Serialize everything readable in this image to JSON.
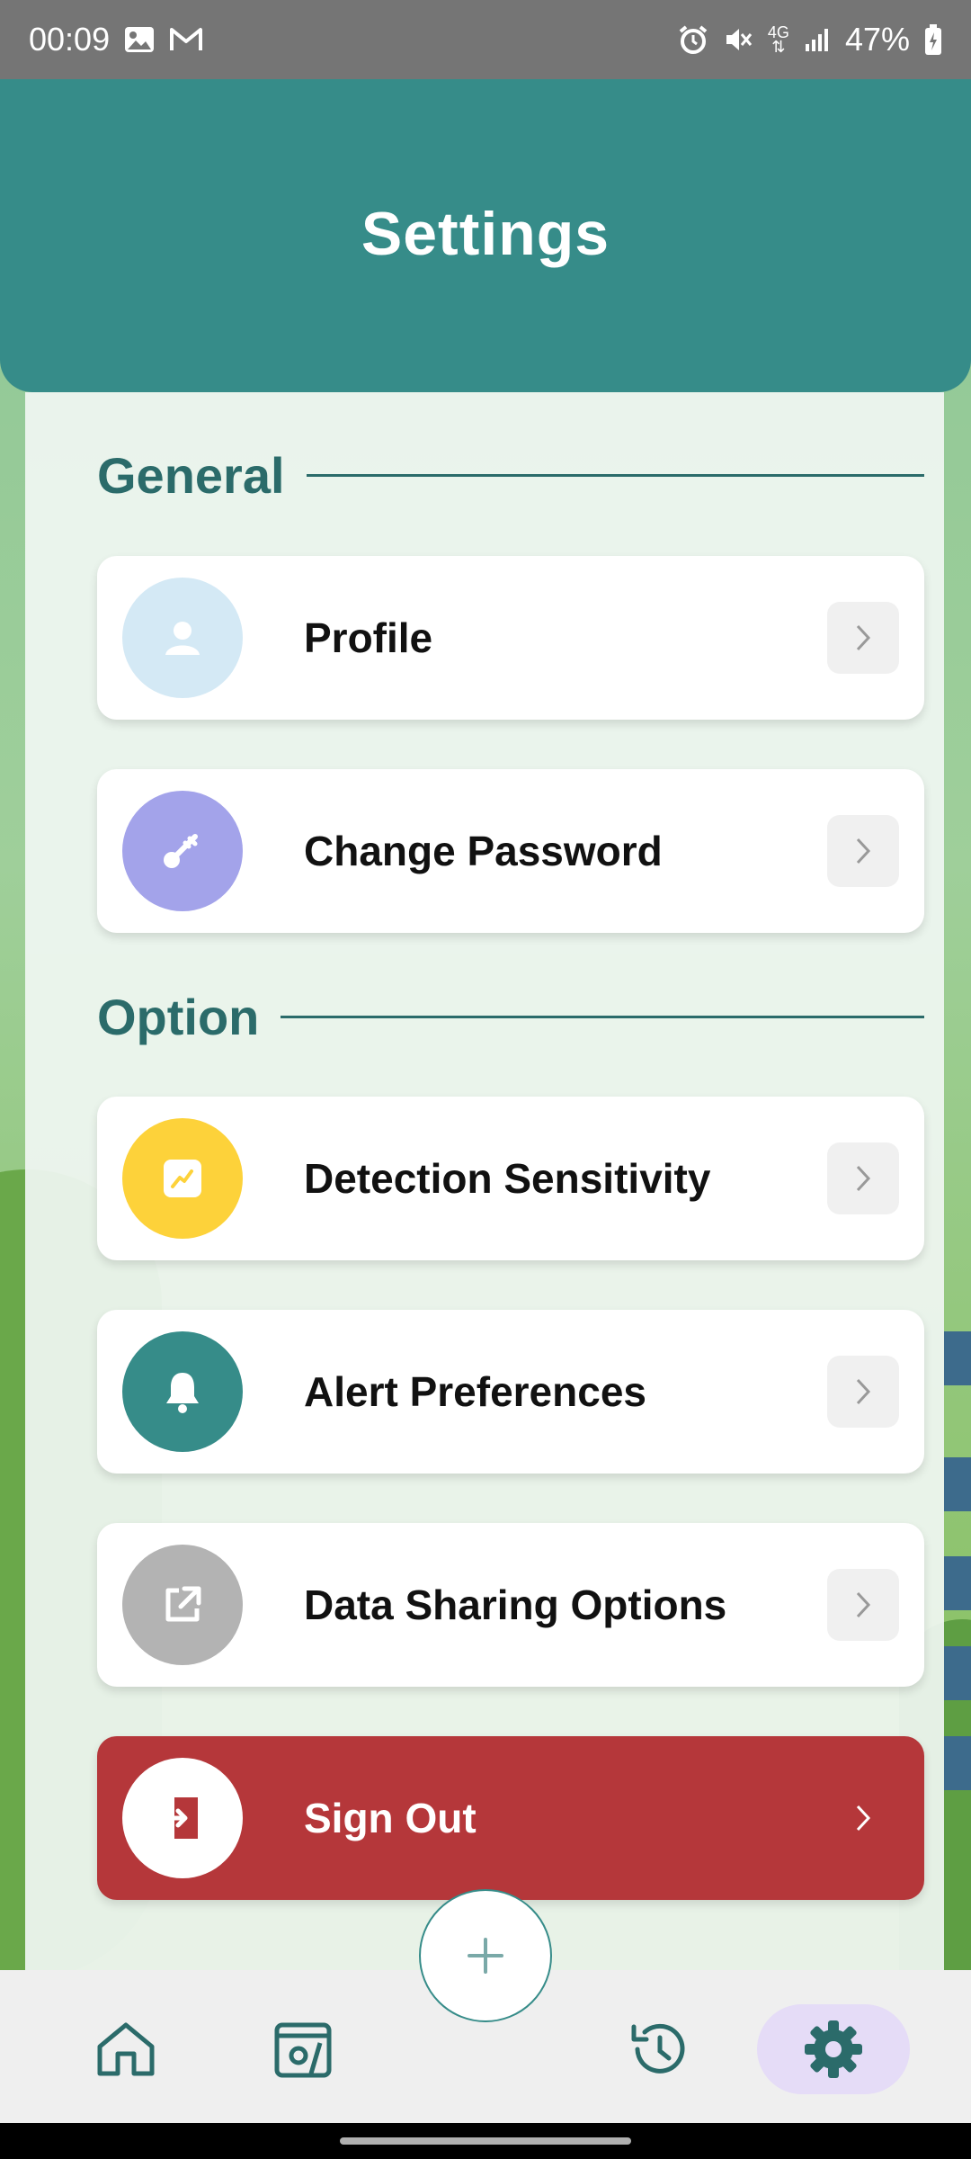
{
  "status_bar": {
    "time": "00:09",
    "battery": "47%",
    "network": "4G"
  },
  "header": {
    "title": "Settings"
  },
  "sections": {
    "general": {
      "title": "General"
    },
    "option": {
      "title": "Option"
    }
  },
  "items": {
    "profile": {
      "label": "Profile",
      "icon": "person-icon",
      "color": "#d4e9f5"
    },
    "change_password": {
      "label": "Change Password",
      "icon": "key-icon",
      "color": "#a3a3ea"
    },
    "detection_sensitivity": {
      "label": "Detection Sensitivity",
      "icon": "trend-icon",
      "color": "#fdd23a"
    },
    "alert_preferences": {
      "label": "Alert Preferences",
      "icon": "bell-icon",
      "color": "#368c89"
    },
    "data_sharing": {
      "label": "Data Sharing Options",
      "icon": "share-icon",
      "color": "#b3b3b3"
    },
    "sign_out": {
      "label": "Sign Out",
      "icon": "sign-out-icon",
      "color": "#b5373a"
    }
  },
  "bottom_nav": {
    "items": [
      "home-icon",
      "gallery-icon",
      "history-icon",
      "settings-icon"
    ],
    "active": "settings-icon",
    "fab_icon": "plus-icon",
    "accent": "#2b6b6a"
  }
}
